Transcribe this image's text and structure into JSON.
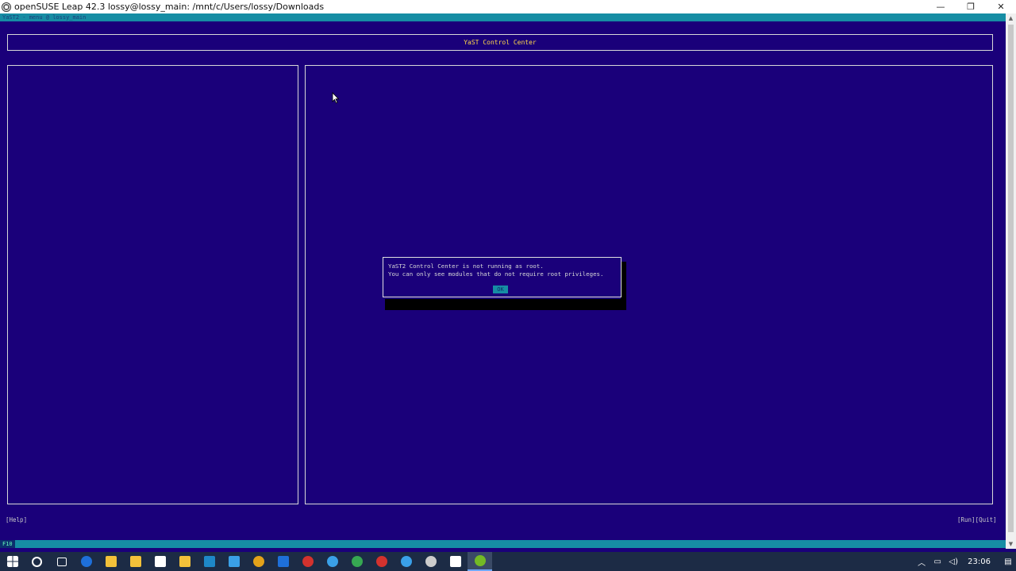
{
  "window": {
    "title": "openSUSE Leap 42.3  lossy@lossy_main: /mnt/c/Users/lossy/Downloads",
    "minimize_glyph": "—",
    "restore_glyph": "❐",
    "close_glyph": "✕"
  },
  "terminal": {
    "top_status": "YaST2 - menu @ lossy_main",
    "header_title": "YaST Control Center",
    "dialog": {
      "line1": "YaST2 Control Center is not running as root.",
      "line2": "You can only see modules that do not require root privileges.",
      "ok_label": "OK"
    },
    "help_label": "[Help]",
    "run_quit_label": "[Run][Quit]",
    "f10_label": "F10"
  },
  "taskbar": {
    "clock": "23:06",
    "icons": [
      {
        "name": "start-icon",
        "color": "#ffffff"
      },
      {
        "name": "search-icon",
        "color": "#ffffff"
      },
      {
        "name": "task-view-icon",
        "color": "#ffffff"
      },
      {
        "name": "edge-old-icon",
        "color": "#1e6fd9"
      },
      {
        "name": "file-explorer-icon",
        "color": "#f3c13a"
      },
      {
        "name": "store-icon",
        "color": "#f3c13a"
      },
      {
        "name": "documents-icon",
        "color": "#ffffff"
      },
      {
        "name": "notes-icon",
        "color": "#f3c13a"
      },
      {
        "name": "calculator-icon",
        "color": "#1e88c8"
      },
      {
        "name": "vscode-icon",
        "color": "#3aa0e8"
      },
      {
        "name": "chrome-icon",
        "color": "#e3a21a"
      },
      {
        "name": "outlook-icon",
        "color": "#1e6fd9"
      },
      {
        "name": "opera-icon",
        "color": "#d3322e"
      },
      {
        "name": "edge-icon",
        "color": "#3aa0e8"
      },
      {
        "name": "upwork-icon",
        "color": "#36a852"
      },
      {
        "name": "recorder-icon",
        "color": "#d3322e"
      },
      {
        "name": "arc-icon",
        "color": "#3aa0e8"
      },
      {
        "name": "obs-icon",
        "color": "#cccccc"
      },
      {
        "name": "window-icon",
        "color": "#ffffff"
      },
      {
        "name": "opensuse-icon",
        "color": "#73ba25"
      }
    ]
  }
}
